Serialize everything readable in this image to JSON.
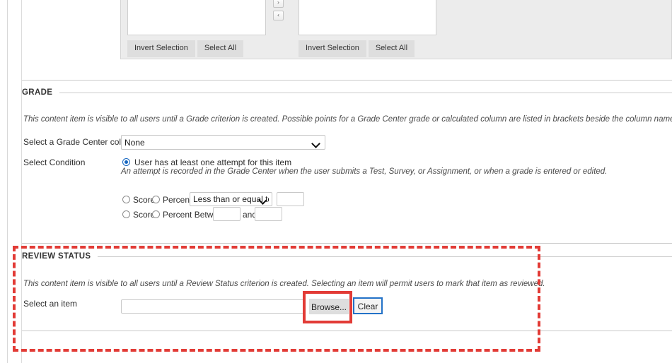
{
  "top_panel": {
    "left_list_buttons": [
      "Invert Selection",
      "Select All"
    ],
    "right_list_buttons": [
      "Invert Selection",
      "Select All"
    ],
    "arrow_right": "›",
    "arrow_left": "‹"
  },
  "grade": {
    "heading": "GRADE",
    "description": "This content item is visible to all users until a Grade criterion is created. Possible points for a Grade Center grade or calculated column are listed in brackets beside the column name. The score entered must be numeric.",
    "column_label": "Select a Grade Center column",
    "column_value": "None",
    "column_options": [
      "None"
    ],
    "condition_label": "Select Condition",
    "condition_option": "User has at least one attempt for this item",
    "condition_help": "An attempt is recorded in the Grade Center when the user submits a Test, Survey, or Assignment, or when a grade is entered or edited.",
    "row1": {
      "score_label": "Score",
      "percent_label": "Percent",
      "operator_value": "Less than or equal to",
      "operator_options": [
        "Less than or equal to"
      ],
      "value": ""
    },
    "row2": {
      "score_label": "Score",
      "percent_label": "Percent Between",
      "from_value": "",
      "and_label": "and",
      "to_value": ""
    }
  },
  "review_status": {
    "heading": "REVIEW STATUS",
    "description": "This content item is visible to all users until a Review Status criterion is created. Selecting an item will permit users to mark that item as reviewed.",
    "select_item_label": "Select an item",
    "select_item_value": "",
    "browse_label": "Browse...",
    "clear_label": "Clear"
  },
  "colors": {
    "highlight": "#e23b36",
    "focus_blue": "#2372c8",
    "radio_blue": "#1566c0",
    "panel_grey": "#ececec",
    "button_grey": "#dedede"
  }
}
